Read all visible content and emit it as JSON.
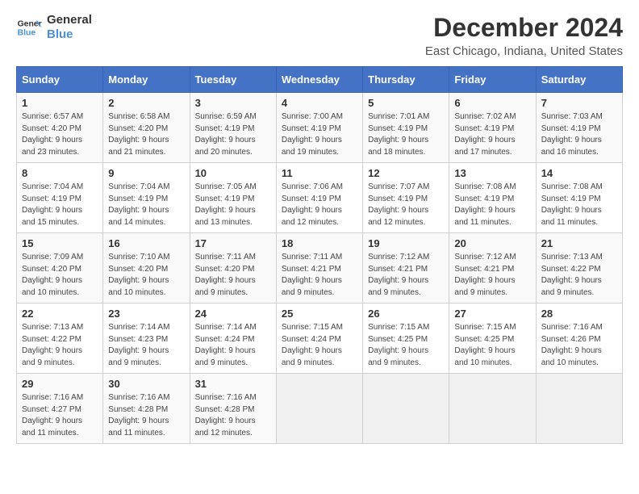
{
  "logo": {
    "text_general": "General",
    "text_blue": "Blue",
    "arrow_color": "#4a90d9"
  },
  "title": "December 2024",
  "subtitle": "East Chicago, Indiana, United States",
  "days_of_week": [
    "Sunday",
    "Monday",
    "Tuesday",
    "Wednesday",
    "Thursday",
    "Friday",
    "Saturday"
  ],
  "weeks": [
    [
      {
        "day": "1",
        "sunrise": "6:57 AM",
        "sunset": "4:20 PM",
        "daylight": "9 hours and 23 minutes."
      },
      {
        "day": "2",
        "sunrise": "6:58 AM",
        "sunset": "4:20 PM",
        "daylight": "9 hours and 21 minutes."
      },
      {
        "day": "3",
        "sunrise": "6:59 AM",
        "sunset": "4:19 PM",
        "daylight": "9 hours and 20 minutes."
      },
      {
        "day": "4",
        "sunrise": "7:00 AM",
        "sunset": "4:19 PM",
        "daylight": "9 hours and 19 minutes."
      },
      {
        "day": "5",
        "sunrise": "7:01 AM",
        "sunset": "4:19 PM",
        "daylight": "9 hours and 18 minutes."
      },
      {
        "day": "6",
        "sunrise": "7:02 AM",
        "sunset": "4:19 PM",
        "daylight": "9 hours and 17 minutes."
      },
      {
        "day": "7",
        "sunrise": "7:03 AM",
        "sunset": "4:19 PM",
        "daylight": "9 hours and 16 minutes."
      }
    ],
    [
      {
        "day": "8",
        "sunrise": "7:04 AM",
        "sunset": "4:19 PM",
        "daylight": "9 hours and 15 minutes."
      },
      {
        "day": "9",
        "sunrise": "7:04 AM",
        "sunset": "4:19 PM",
        "daylight": "9 hours and 14 minutes."
      },
      {
        "day": "10",
        "sunrise": "7:05 AM",
        "sunset": "4:19 PM",
        "daylight": "9 hours and 13 minutes."
      },
      {
        "day": "11",
        "sunrise": "7:06 AM",
        "sunset": "4:19 PM",
        "daylight": "9 hours and 12 minutes."
      },
      {
        "day": "12",
        "sunrise": "7:07 AM",
        "sunset": "4:19 PM",
        "daylight": "9 hours and 12 minutes."
      },
      {
        "day": "13",
        "sunrise": "7:08 AM",
        "sunset": "4:19 PM",
        "daylight": "9 hours and 11 minutes."
      },
      {
        "day": "14",
        "sunrise": "7:08 AM",
        "sunset": "4:19 PM",
        "daylight": "9 hours and 11 minutes."
      }
    ],
    [
      {
        "day": "15",
        "sunrise": "7:09 AM",
        "sunset": "4:20 PM",
        "daylight": "9 hours and 10 minutes."
      },
      {
        "day": "16",
        "sunrise": "7:10 AM",
        "sunset": "4:20 PM",
        "daylight": "9 hours and 10 minutes."
      },
      {
        "day": "17",
        "sunrise": "7:11 AM",
        "sunset": "4:20 PM",
        "daylight": "9 hours and 9 minutes."
      },
      {
        "day": "18",
        "sunrise": "7:11 AM",
        "sunset": "4:21 PM",
        "daylight": "9 hours and 9 minutes."
      },
      {
        "day": "19",
        "sunrise": "7:12 AM",
        "sunset": "4:21 PM",
        "daylight": "9 hours and 9 minutes."
      },
      {
        "day": "20",
        "sunrise": "7:12 AM",
        "sunset": "4:21 PM",
        "daylight": "9 hours and 9 minutes."
      },
      {
        "day": "21",
        "sunrise": "7:13 AM",
        "sunset": "4:22 PM",
        "daylight": "9 hours and 9 minutes."
      }
    ],
    [
      {
        "day": "22",
        "sunrise": "7:13 AM",
        "sunset": "4:22 PM",
        "daylight": "9 hours and 9 minutes."
      },
      {
        "day": "23",
        "sunrise": "7:14 AM",
        "sunset": "4:23 PM",
        "daylight": "9 hours and 9 minutes."
      },
      {
        "day": "24",
        "sunrise": "7:14 AM",
        "sunset": "4:24 PM",
        "daylight": "9 hours and 9 minutes."
      },
      {
        "day": "25",
        "sunrise": "7:15 AM",
        "sunset": "4:24 PM",
        "daylight": "9 hours and 9 minutes."
      },
      {
        "day": "26",
        "sunrise": "7:15 AM",
        "sunset": "4:25 PM",
        "daylight": "9 hours and 9 minutes."
      },
      {
        "day": "27",
        "sunrise": "7:15 AM",
        "sunset": "4:25 PM",
        "daylight": "9 hours and 10 minutes."
      },
      {
        "day": "28",
        "sunrise": "7:16 AM",
        "sunset": "4:26 PM",
        "daylight": "9 hours and 10 minutes."
      }
    ],
    [
      {
        "day": "29",
        "sunrise": "7:16 AM",
        "sunset": "4:27 PM",
        "daylight": "9 hours and 11 minutes."
      },
      {
        "day": "30",
        "sunrise": "7:16 AM",
        "sunset": "4:28 PM",
        "daylight": "9 hours and 11 minutes."
      },
      {
        "day": "31",
        "sunrise": "7:16 AM",
        "sunset": "4:28 PM",
        "daylight": "9 hours and 12 minutes."
      },
      null,
      null,
      null,
      null
    ]
  ],
  "labels": {
    "sunrise": "Sunrise:",
    "sunset": "Sunset:",
    "daylight": "Daylight:"
  }
}
